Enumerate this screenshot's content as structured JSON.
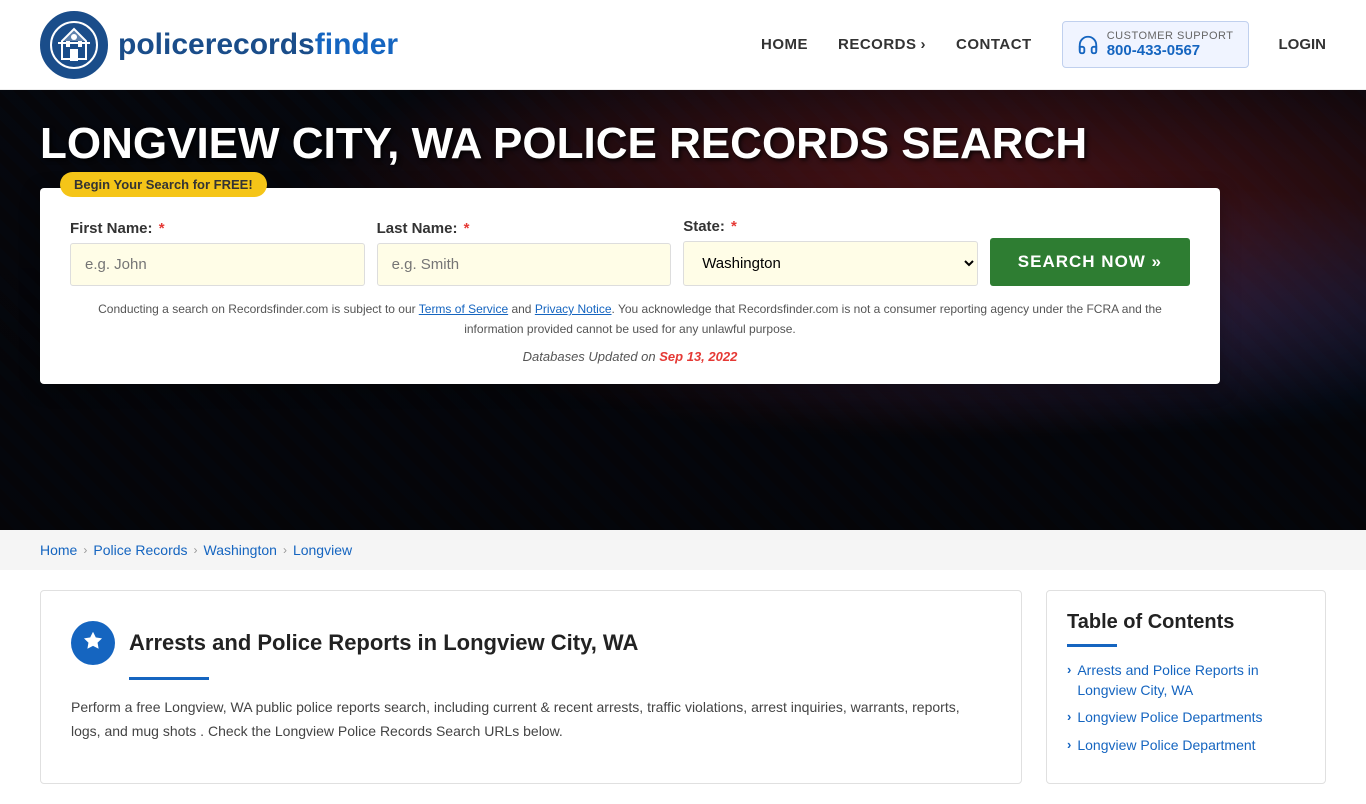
{
  "header": {
    "logo_text_normal": "policerecords",
    "logo_text_bold": "finder",
    "nav": {
      "home": "HOME",
      "records": "RECORDS",
      "contact": "CONTACT",
      "login": "LOGIN"
    },
    "support": {
      "label": "CUSTOMER SUPPORT",
      "phone": "800-433-0567"
    }
  },
  "hero": {
    "title": "LONGVIEW CITY, WA POLICE RECORDS SEARCH",
    "badge": "Begin Your Search for FREE!",
    "search": {
      "first_name_label": "First Name:",
      "last_name_label": "Last Name:",
      "state_label": "State:",
      "first_name_placeholder": "e.g. John",
      "last_name_placeholder": "e.g. Smith",
      "state_value": "Washington",
      "button_label": "SEARCH NOW »",
      "disclaimer": "Conducting a search on Recordsfinder.com is subject to our Terms of Service and Privacy Notice. You acknowledge that Recordsfinder.com is not a consumer reporting agency under the FCRA and the information provided cannot be used for any unlawful purpose.",
      "tos_link": "Terms of Service",
      "privacy_link": "Privacy Notice",
      "db_text": "Databases Updated on",
      "db_date": "Sep 13, 2022"
    }
  },
  "breadcrumb": {
    "home": "Home",
    "police_records": "Police Records",
    "state": "Washington",
    "city": "Longview"
  },
  "main": {
    "left": {
      "section_title": "Arrests and Police Reports in Longview City, WA",
      "body": "Perform a free Longview, WA public police reports search, including current & recent arrests, traffic violations, arrest inquiries, warrants, reports, logs, and mug shots . Check the Longview Police Records Search URLs below."
    },
    "toc": {
      "title": "Table of Contents",
      "items": [
        "Arrests and Police Reports in Longview City, WA",
        "Longview Police Departments",
        "Longview Police Department"
      ]
    }
  }
}
